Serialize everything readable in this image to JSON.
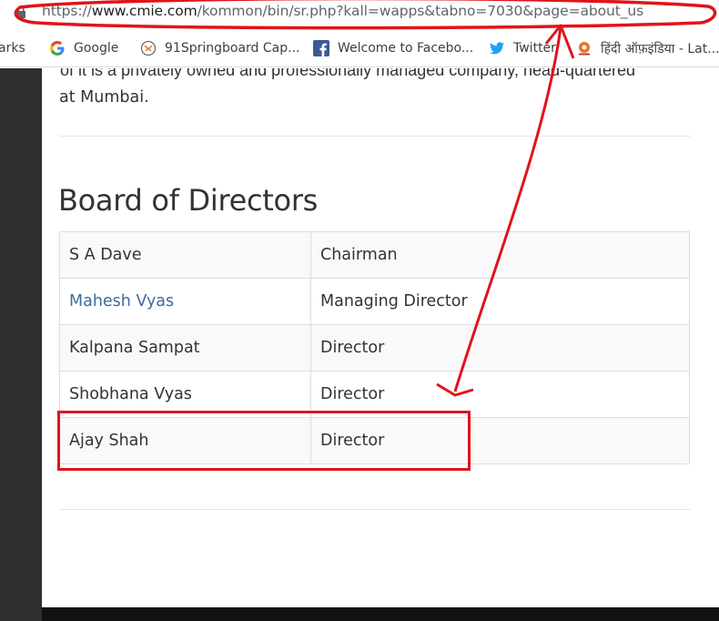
{
  "browser": {
    "url_host_prefix": "https://",
    "url_host": "www.cmie.com",
    "url_path": "/kommon/bin/sr.php?kall=wapps&tabno=7030&page=about_us",
    "bookmarks": [
      {
        "label": "arks",
        "icon": "bookmark-folder-icon"
      },
      {
        "label": "Google",
        "icon": "google-icon"
      },
      {
        "label": "91Springboard Cap...",
        "icon": "springboard-icon"
      },
      {
        "label": "Welcome to Facebo...",
        "icon": "facebook-icon"
      },
      {
        "label": "Twitter",
        "icon": "twitter-icon"
      },
      {
        "label": "हिंदी ऑफ़इंडिया - Lat...",
        "icon": "hindi-news-icon"
      }
    ]
  },
  "page": {
    "cut_line": "of it is a privately owned and professionally managed company, head-quartered",
    "intro_tail": "at Mumbai.",
    "section_title": "Board of Directors",
    "board": [
      {
        "name": "S A Dave",
        "role": "Chairman",
        "link": false
      },
      {
        "name": "Mahesh Vyas",
        "role": "Managing Director",
        "link": true
      },
      {
        "name": "Kalpana Sampat",
        "role": "Director",
        "link": false
      },
      {
        "name": "Shobhana Vyas",
        "role": "Director",
        "link": false
      },
      {
        "name": "Ajay Shah",
        "role": "Director",
        "link": false
      }
    ]
  },
  "colors": {
    "annotation_red": "#e0141b",
    "link_blue": "#3d6b9e",
    "text": "#333333"
  }
}
